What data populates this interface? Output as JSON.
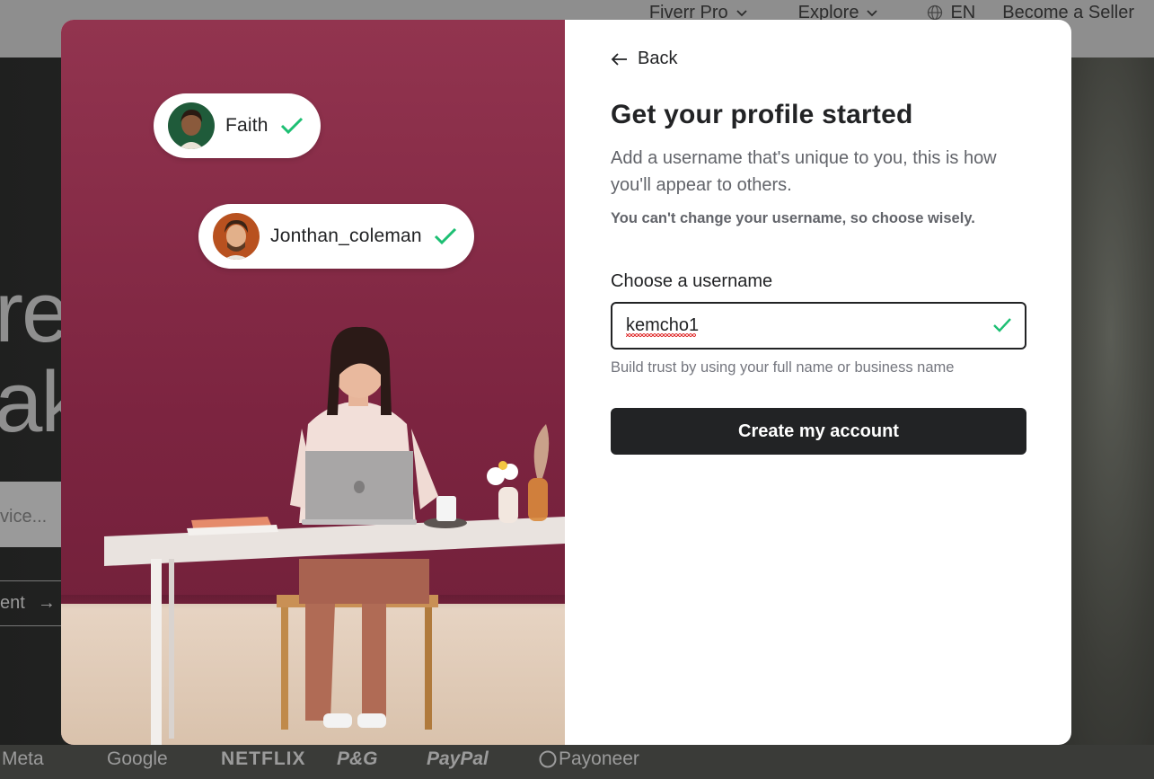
{
  "background": {
    "nav": [
      {
        "label": "Fiverr Pro",
        "has_chevron": true
      },
      {
        "label": "Explore",
        "has_chevron": true
      },
      {
        "label": "EN",
        "icon": "globe-icon"
      },
      {
        "label": "Become a Seller"
      }
    ],
    "hero_fragments": [
      "re",
      "ake"
    ],
    "search_placeholder_fragment": "vice...",
    "link_fragment": "ent",
    "trusted_logos": [
      "Meta",
      "Google",
      "NETFLIX",
      "P&G",
      "PayPal",
      "Payoneer"
    ]
  },
  "modal": {
    "chips": [
      {
        "name": "Faith",
        "verified": true
      },
      {
        "name": "Jonthan_coleman",
        "verified": true
      }
    ],
    "back_label": "Back",
    "title": "Get your profile started",
    "subtitle": "Add a username that's unique to you, this is how you'll appear to others.",
    "warning": "You can't change your username, so choose wisely.",
    "username_label": "Choose a username",
    "username_value": "kemcho1",
    "username_valid": true,
    "helper_text": "Build trust by using your full name or business name",
    "submit_label": "Create my account"
  },
  "colors": {
    "brand_dark": "#222325",
    "success_green": "#1dbf73",
    "panel_magenta": "#7c2440"
  }
}
